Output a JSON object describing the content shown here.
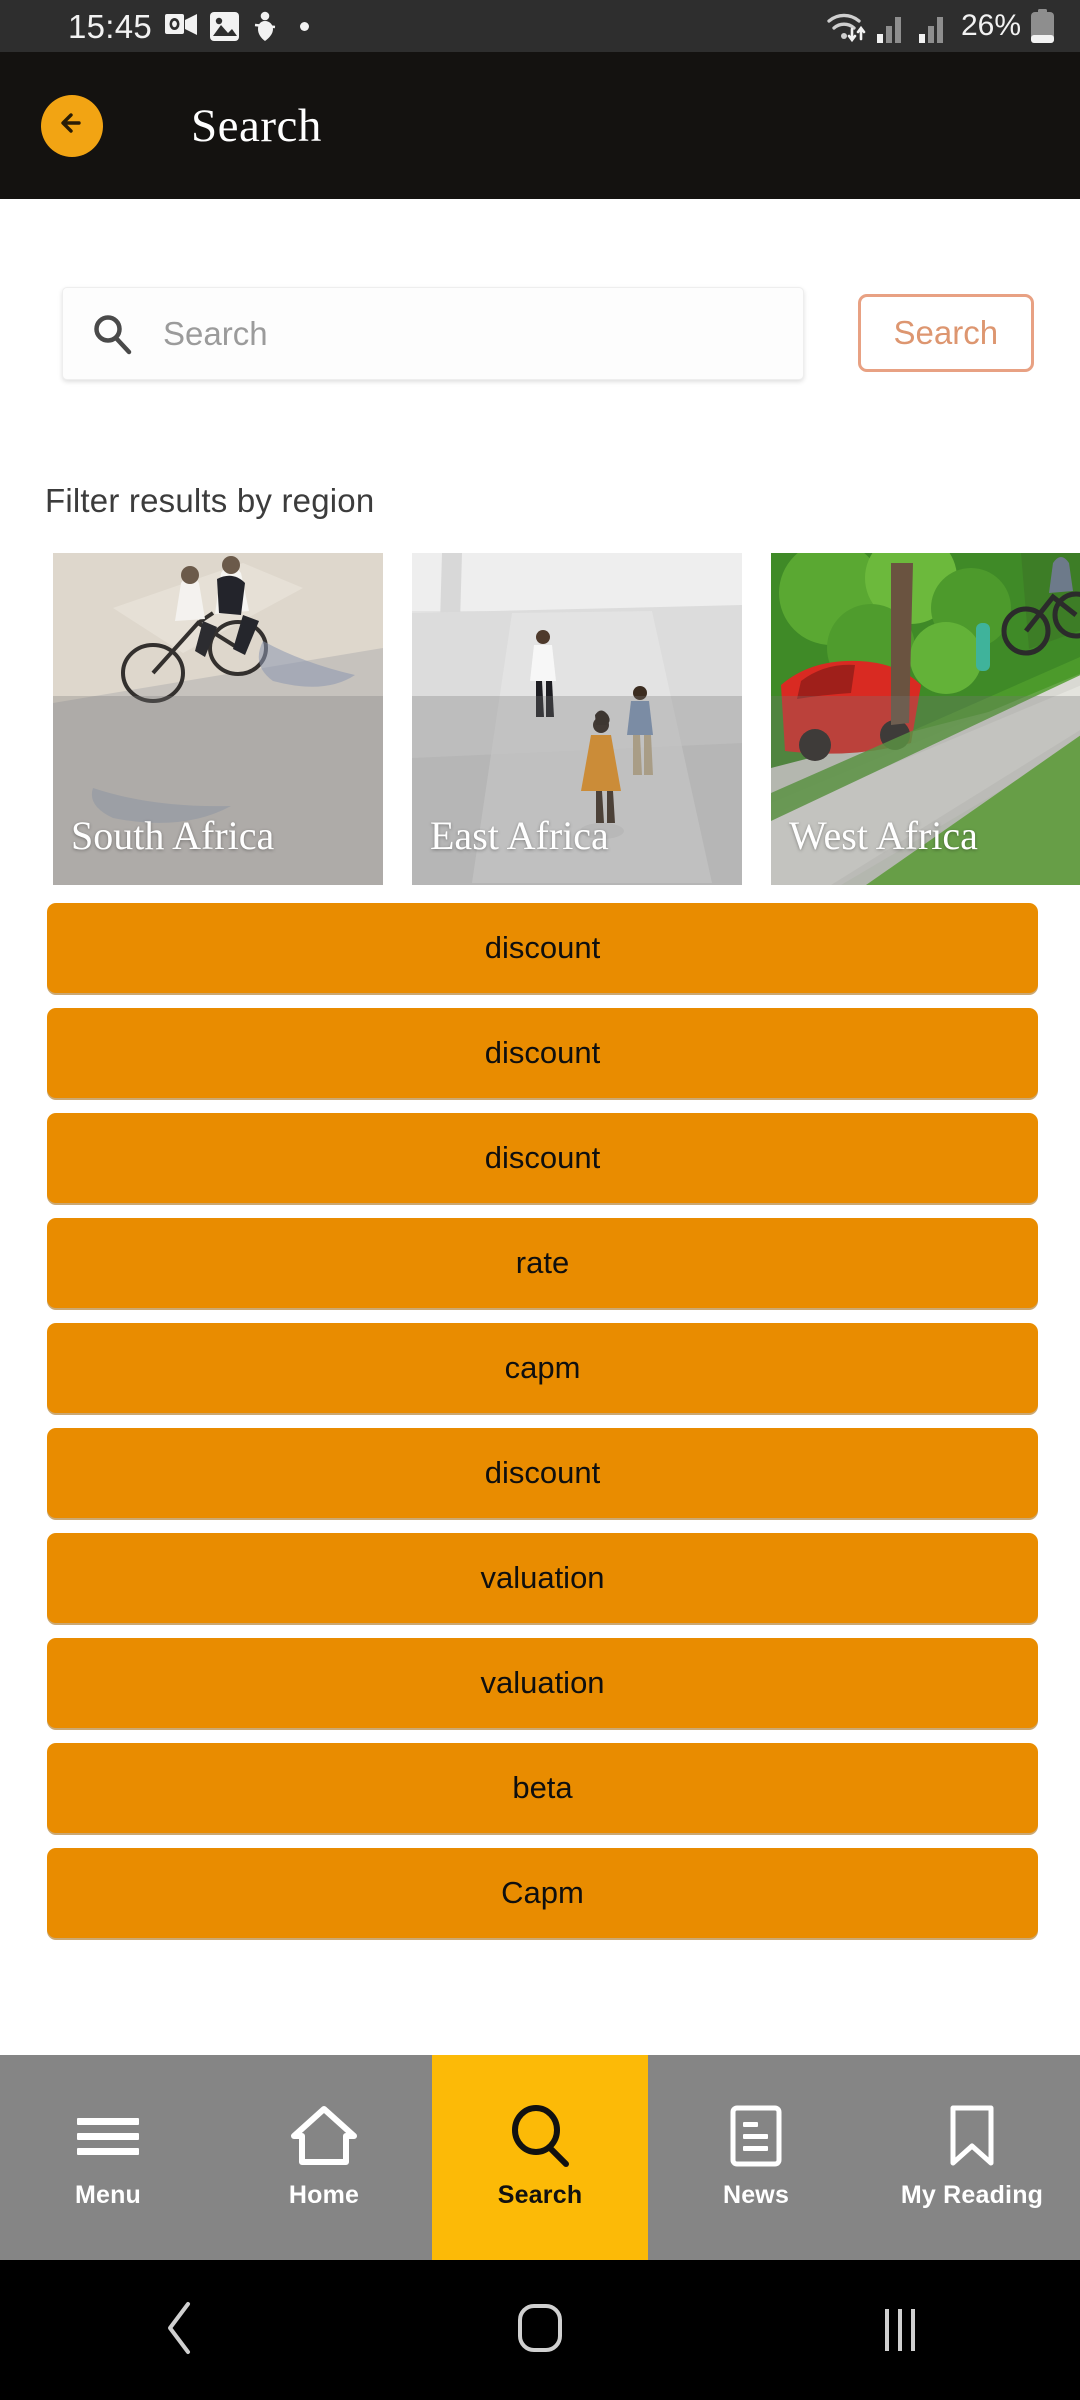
{
  "status_bar": {
    "time": "15:45",
    "battery_percent": "26%",
    "left_icons": [
      "outlook-icon",
      "gallery-image-icon",
      "accessibility-icon",
      "dot-indicator-icon"
    ],
    "right_icons": [
      "wifi-icon",
      "signal-bars-sim1-icon",
      "signal-bars-sim2-icon",
      "battery-icon"
    ],
    "background": "#2e2e2e"
  },
  "app_bar": {
    "title": "Search",
    "back_icon": "arrow-left-icon",
    "background": "#141210",
    "accent": "#f2a413"
  },
  "search": {
    "icon": "magnifier-icon",
    "value": "",
    "placeholder": "Search",
    "button_label": "Search",
    "button_border_color": "#e8a183",
    "button_text_color": "#dd9670"
  },
  "filter": {
    "label": "Filter results by region",
    "regions": [
      {
        "name": "South Africa",
        "scene": "cyclists-on-road"
      },
      {
        "name": "East Africa",
        "scene": "people-on-plaza"
      },
      {
        "name": "West Africa",
        "scene": "tree-lined-sidewalk-red-car"
      }
    ]
  },
  "tags": {
    "color": "#e98c00",
    "text_color": "#0f0f0f",
    "items": [
      "discount",
      "discount",
      "discount",
      "rate",
      "capm",
      "discount",
      "valuation",
      "valuation",
      "beta",
      "Capm"
    ]
  },
  "bottom_nav": {
    "background": "#858585",
    "active_background": "#fcba07",
    "active_index": 2,
    "items": [
      {
        "label": "Menu",
        "icon": "hamburger-menu-icon"
      },
      {
        "label": "Home",
        "icon": "house-icon"
      },
      {
        "label": "Search",
        "icon": "magnifier-icon"
      },
      {
        "label": "News",
        "icon": "document-lines-icon"
      },
      {
        "label": "My Reading",
        "icon": "bookmark-icon"
      }
    ]
  },
  "android_nav": {
    "back": "chevron-back-icon",
    "home": "home-square-icon",
    "recents": "recents-lines-icon"
  }
}
